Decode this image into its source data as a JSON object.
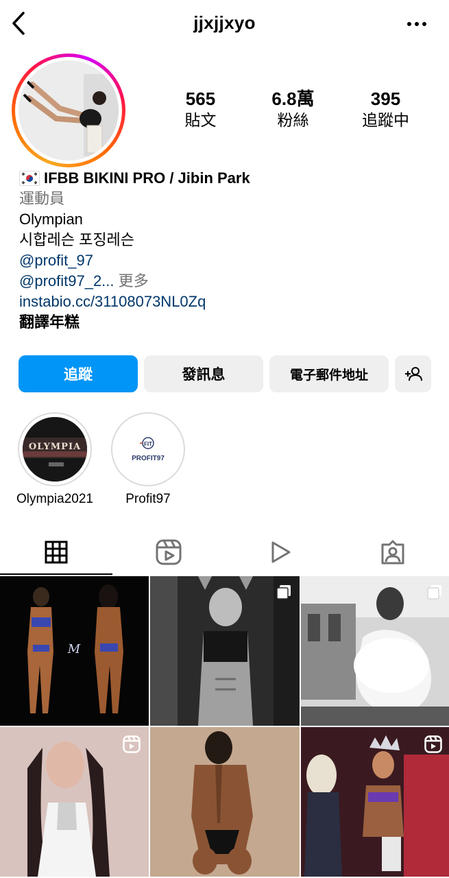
{
  "header": {
    "username": "jjxjjxyo"
  },
  "stats": [
    {
      "value": "565",
      "label": "貼文"
    },
    {
      "value": "6.8萬",
      "label": "粉絲"
    },
    {
      "value": "395",
      "label": "追蹤中"
    }
  ],
  "bio": {
    "name": "IFBB BIKINI PRO / Jibin Park",
    "category": "運動員",
    "line1": "Olympian",
    "line2": "시합레슨 포징레슨",
    "mention1": "@profit_97",
    "mention2": "@profit97_2...",
    "more": "更多",
    "website": "instabio.cc/31108073NL0Zq",
    "translate": "翻譯年糕"
  },
  "actions": {
    "follow": "追蹤",
    "message": "發訊息",
    "email": "電子郵件地址"
  },
  "highlights": [
    {
      "label": "Olympia2021",
      "cover_text": "OLYMPIA"
    },
    {
      "label": "Profit97",
      "cover_text": "PROFIT97",
      "cover_logo": "FIT"
    }
  ],
  "tabs": [
    "grid-icon",
    "reels-icon",
    "video-icon",
    "tagged-icon"
  ],
  "colors": {
    "follow": "#0095f6",
    "link": "#00376b",
    "muted": "#737373",
    "button_bg": "#efefef"
  }
}
